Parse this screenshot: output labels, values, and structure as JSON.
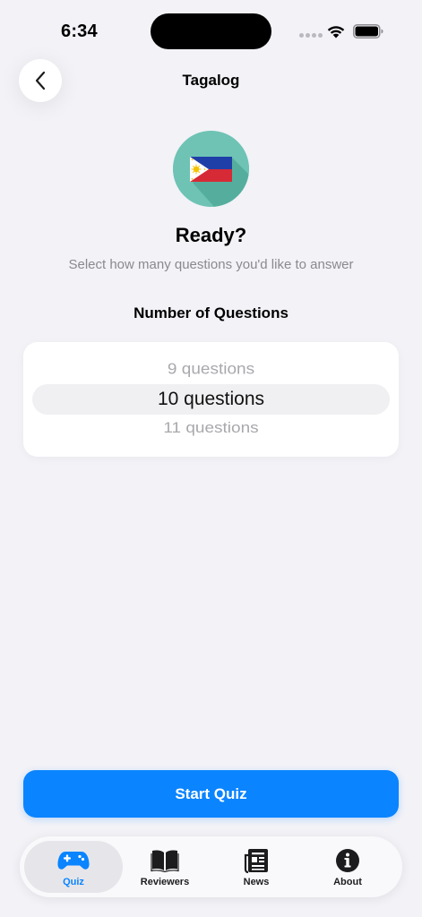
{
  "status_bar": {
    "time": "6:34"
  },
  "header": {
    "title": "Tagalog",
    "back_icon": "chevron-left-icon"
  },
  "hero": {
    "flag_icon": "philippines-flag-icon",
    "title": "Ready?",
    "subtitle": "Select how many questions you'd like to answer"
  },
  "picker": {
    "label": "Number of Questions",
    "previous_option": "9 questions",
    "selected_option": "10 questions",
    "next_option": "11 questions"
  },
  "start_button": {
    "label": "Start Quiz"
  },
  "tab_bar": {
    "tabs": [
      {
        "label": "Quiz",
        "icon": "gamecontroller-icon",
        "active": true
      },
      {
        "label": "Reviewers",
        "icon": "book-icon",
        "active": false
      },
      {
        "label": "News",
        "icon": "newspaper-icon",
        "active": false
      },
      {
        "label": "About",
        "icon": "info-icon",
        "active": false
      }
    ]
  },
  "colors": {
    "accent": "#0a84ff",
    "background": "#f2f2f7",
    "badge": "#6ec3b4",
    "muted_text": "#8a8a8e"
  }
}
